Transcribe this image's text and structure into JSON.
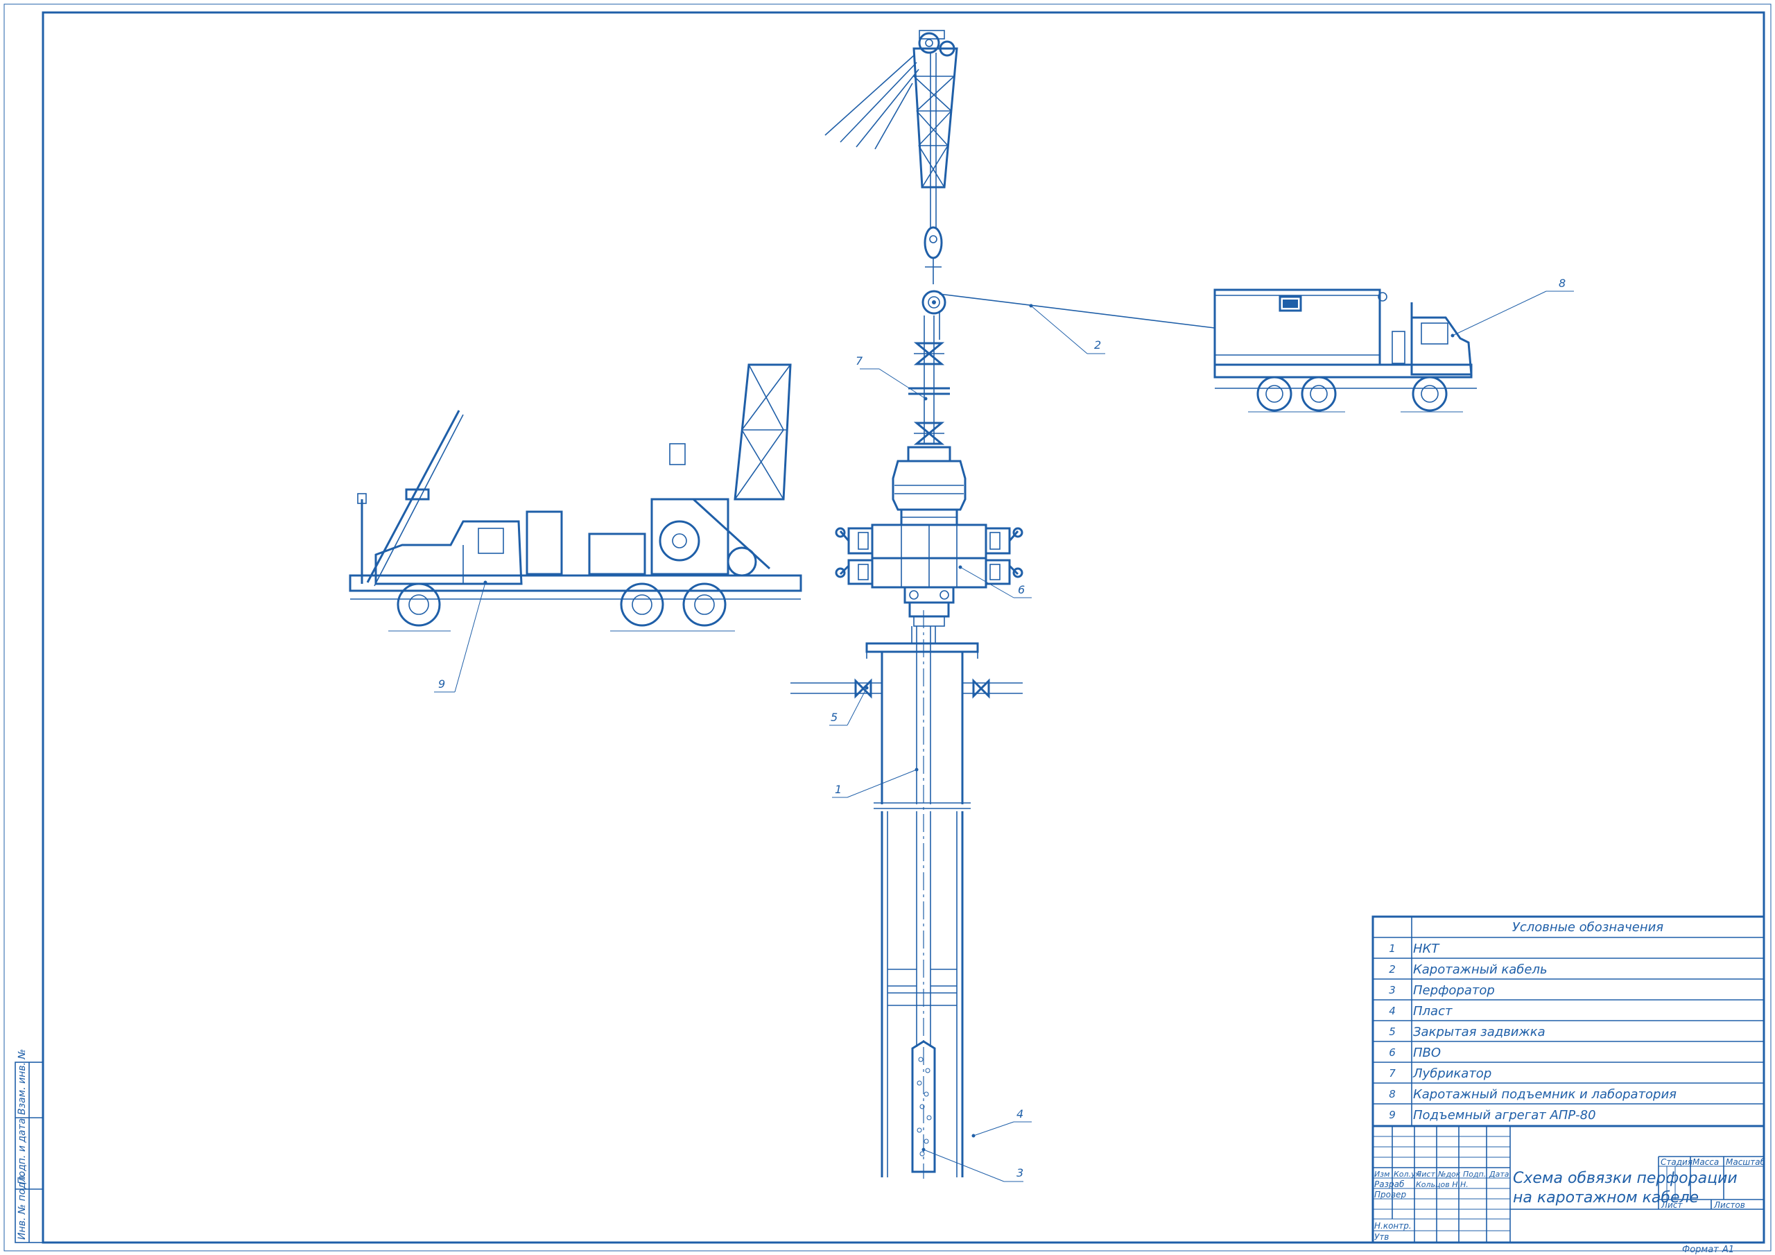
{
  "callouts": {
    "c1": "1",
    "c2": "2",
    "c3": "3",
    "c4": "4",
    "c5": "5",
    "c6": "6",
    "c7": "7",
    "c8": "8",
    "c9": "9"
  },
  "legend": {
    "title": "Условные обозначения",
    "items": [
      {
        "num": "1",
        "label": "НКТ"
      },
      {
        "num": "2",
        "label": "Каротажный кабель"
      },
      {
        "num": "3",
        "label": "Перфоратор"
      },
      {
        "num": "4",
        "label": "Пласт"
      },
      {
        "num": "5",
        "label": "Закрытая задвижка"
      },
      {
        "num": "6",
        "label": "ПВО"
      },
      {
        "num": "7",
        "label": "Лубрикатор"
      },
      {
        "num": "8",
        "label": "Каротажный подъемник и лаборатория"
      },
      {
        "num": "9",
        "label": "Подъемный агрегат АПР-80"
      }
    ]
  },
  "title_block": {
    "col_izm": "Изм",
    "col_kol": "Кол.уч",
    "col_list": "Лист",
    "col_doc": "№док",
    "col_podp": "Подп.",
    "col_data": "Дата",
    "razrab": "Разраб",
    "razrab_name": "Кольцов Н.Н.",
    "prover": "Провер",
    "nkontr": "Н.контр.",
    "utv": "Утв",
    "title_line1": "Схема обвязки перфорации",
    "title_line2": "на каротажном кабеле",
    "stadiya": "Стадия",
    "massa": "Масса",
    "masshtab": "Масштаб",
    "list": "Лист",
    "listov": "Листов"
  },
  "side_stamp": {
    "inv_podl": "Инв. № подл.",
    "podp_data": "Подп. и дата",
    "vzam_inv": "Взам. инв. №"
  },
  "format": {
    "label": "Формат",
    "value": "А1"
  },
  "colors": {
    "line": "#1f5fa8",
    "background": "#ffffff"
  }
}
